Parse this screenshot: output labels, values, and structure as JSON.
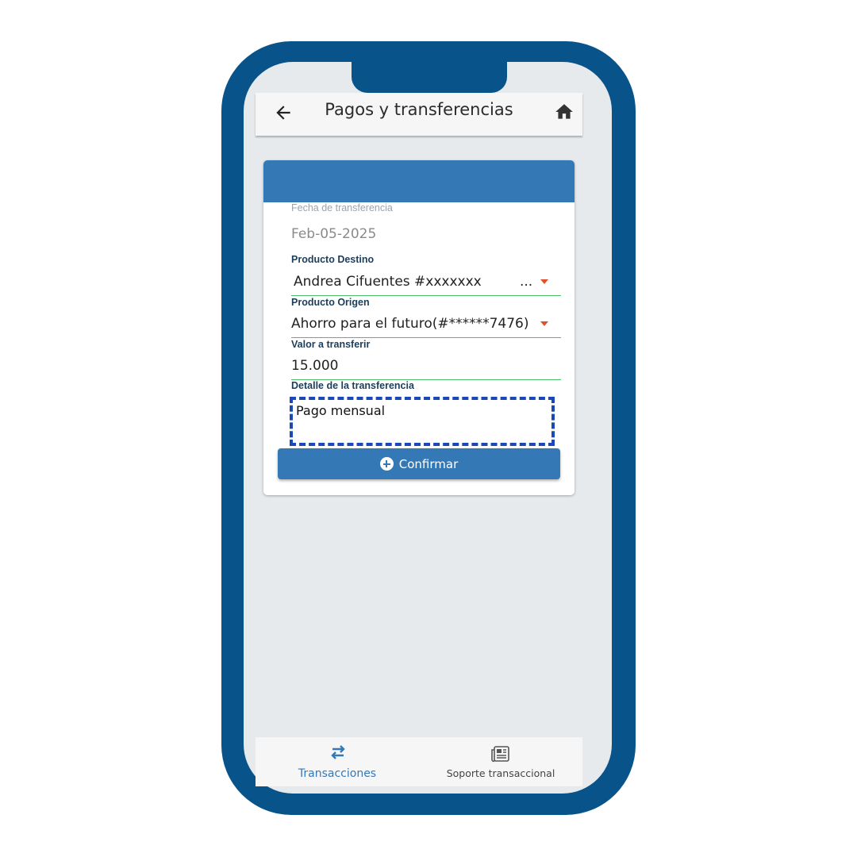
{
  "header": {
    "title": "Pagos y transferencias",
    "back_icon": "arrow-left-icon",
    "home_icon": "home-icon"
  },
  "form": {
    "fecha": {
      "label": "Fecha de transferencia",
      "value": "Feb-05-2025"
    },
    "destino": {
      "label": "Producto Destino",
      "value": "Andrea Cifuentes #xxxxxxx",
      "overflow": "..."
    },
    "origen": {
      "label": "Producto Origen",
      "value": "Ahorro para el futuro(#******7476)"
    },
    "valor": {
      "label": "Valor a transferir",
      "value": "15.000"
    },
    "detalle": {
      "label": "Detalle de la transferencia",
      "value": "Pago mensual"
    },
    "confirm_label": "Confirmar"
  },
  "bottom_nav": {
    "items": [
      {
        "label": "Transacciones",
        "icon": "swap-arrows-icon",
        "active": true
      },
      {
        "label": "Soporte transaccional",
        "icon": "newspaper-icon",
        "active": false
      }
    ]
  },
  "colors": {
    "frame": "#07538a",
    "primary": "#3479b6",
    "accent_caret": "#e2502b",
    "underline": "#4cbf6a",
    "highlight": "#1a48b8"
  }
}
